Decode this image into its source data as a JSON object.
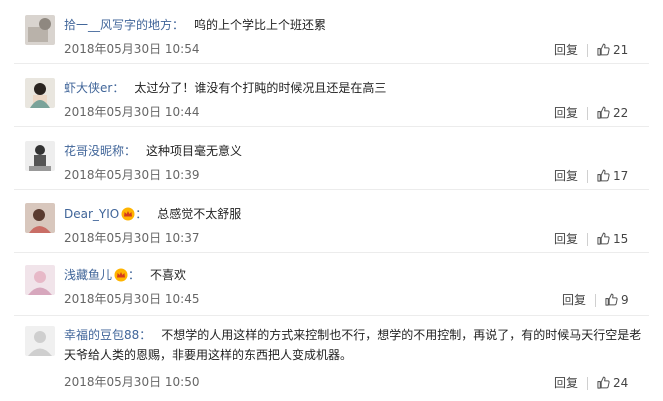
{
  "comments": [
    {
      "user": "拾一__风写字的地方",
      "text": "呜的上个学比上个班还累",
      "time": "2018年05月30日 10:54",
      "reply": "回复",
      "likes": "21"
    },
    {
      "user": "虾大侠er",
      "text": "太过分了！谁没有个打盹的时候况且还是在高三",
      "time": "2018年05月30日 10:44",
      "reply": "回复",
      "likes": "22"
    },
    {
      "user": "花哥没昵称",
      "text": "这种项目毫无意义",
      "time": "2018年05月30日 10:39",
      "reply": "回复",
      "likes": "17"
    },
    {
      "user": "Dear_YIO",
      "text": "总感觉不太舒服",
      "time": "2018年05月30日 10:37",
      "reply": "回复",
      "likes": "15"
    },
    {
      "user": "浅藏鱼儿",
      "text": "不喜欢",
      "time": "2018年05月30日 10:45",
      "reply": "回复",
      "likes": "9"
    },
    {
      "user": "幸福的豆包88",
      "text_line1": "不想学的人用这样的方式来控制也不行，想学的不用控制，再说了，有的时候马天行空是老",
      "text_line2": "天爷给人类的恩赐，非要用这样的东西把人变成机器。",
      "time": "2018年05月30日 10:50",
      "reply": "回复",
      "likes": "24"
    }
  ],
  "colors": {
    "username": "#406599",
    "text": "#222222",
    "meta": "#666666"
  },
  "icons": {
    "like": "thumbs-up-icon",
    "badge": "crown-badge-icon"
  }
}
